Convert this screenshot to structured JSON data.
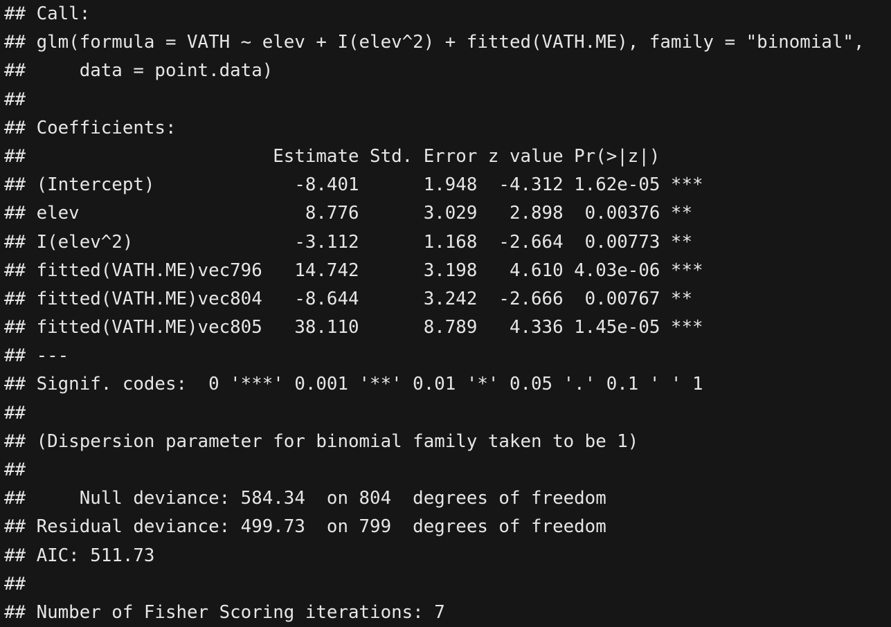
{
  "lines": [
    "## Call:",
    "## glm(formula = VATH ~ elev + I(elev^2) + fitted(VATH.ME), family = \"binomial\",",
    "##     data = point.data)",
    "##",
    "## Coefficients:",
    "##                       Estimate Std. Error z value Pr(>|z|)",
    "## (Intercept)             -8.401      1.948  -4.312 1.62e-05 ***",
    "## elev                     8.776      3.029   2.898  0.00376 **",
    "## I(elev^2)               -3.112      1.168  -2.664  0.00773 **",
    "## fitted(VATH.ME)vec796   14.742      3.198   4.610 4.03e-06 ***",
    "## fitted(VATH.ME)vec804   -8.644      3.242  -2.666  0.00767 **",
    "## fitted(VATH.ME)vec805   38.110      8.789   4.336 1.45e-05 ***",
    "## ---",
    "## Signif. codes:  0 '***' 0.001 '**' 0.01 '*' 0.05 '.' 0.1 ' ' 1",
    "##",
    "## (Dispersion parameter for binomial family taken to be 1)",
    "##",
    "##     Null deviance: 584.34  on 804  degrees of freedom",
    "## Residual deviance: 499.73  on 799  degrees of freedom",
    "## AIC: 511.73",
    "##",
    "## Number of Fisher Scoring iterations: 7"
  ]
}
